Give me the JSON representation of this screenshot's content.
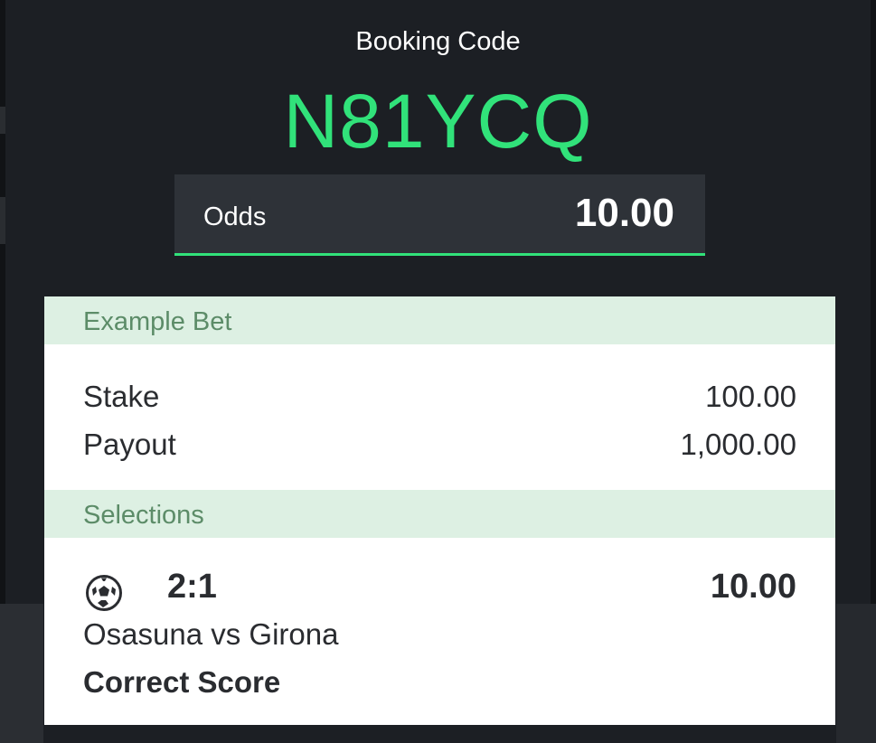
{
  "booking": {
    "label": "Booking Code",
    "code": "N81YCQ",
    "odds_label": "Odds",
    "odds_value": "10.00",
    "accent_color": "#31e27a"
  },
  "example_bet": {
    "header": "Example Bet",
    "stake_label": "Stake",
    "stake_value": "100.00",
    "payout_label": "Payout",
    "payout_value": "1,000.00"
  },
  "selections": {
    "header": "Selections",
    "items": [
      {
        "icon": "soccer-ball-icon",
        "pick": "2:1",
        "odds": "10.00",
        "match": "Osasuna vs Girona",
        "market": "Correct Score"
      }
    ]
  }
}
